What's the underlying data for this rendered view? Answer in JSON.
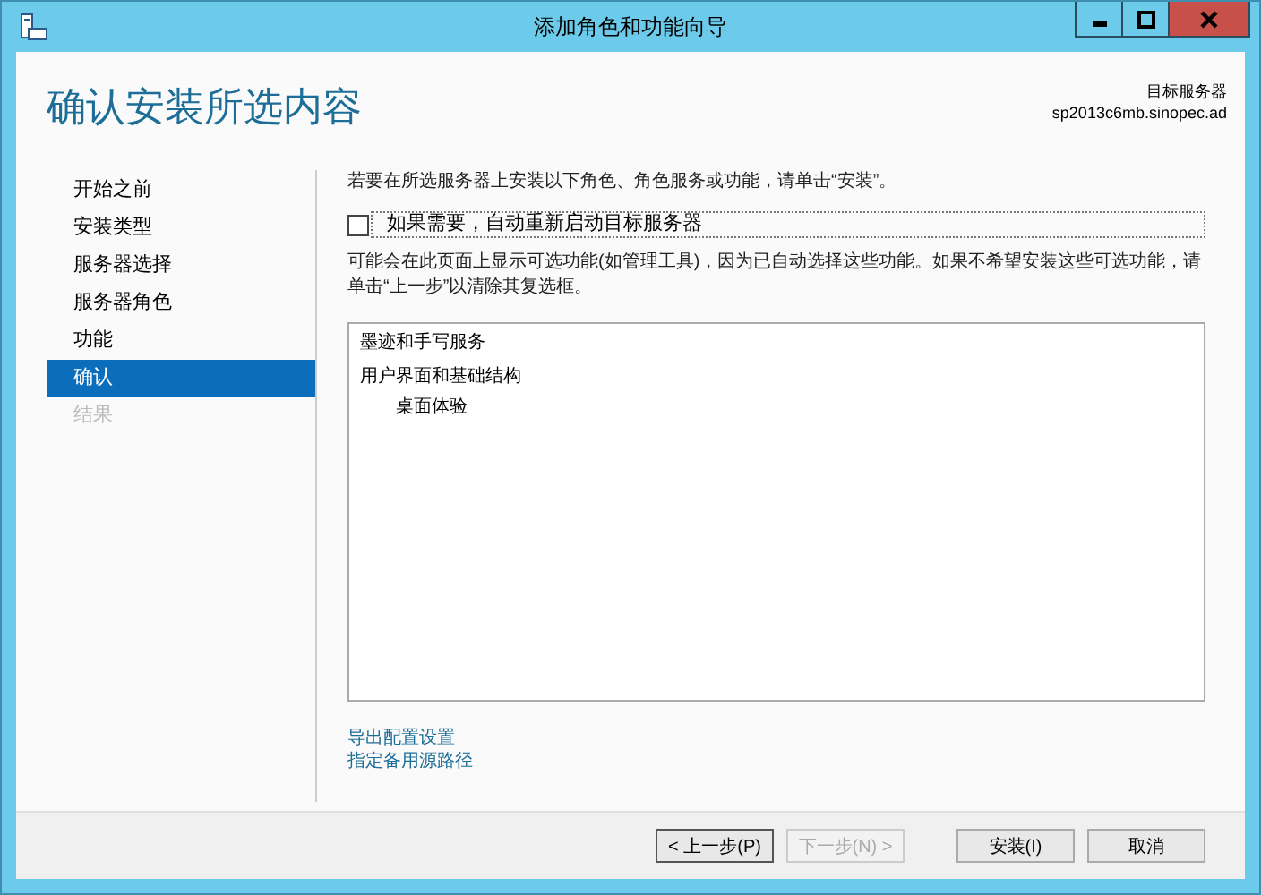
{
  "window": {
    "title": "添加角色和功能向导"
  },
  "header": {
    "title": "确认安装所选内容",
    "server_label": "目标服务器",
    "server_name": "sp2013c6mb.sinopec.ad"
  },
  "sidebar": {
    "items": [
      {
        "label": "开始之前",
        "selected": false,
        "disabled": false
      },
      {
        "label": "安装类型",
        "selected": false,
        "disabled": false
      },
      {
        "label": "服务器选择",
        "selected": false,
        "disabled": false
      },
      {
        "label": "服务器角色",
        "selected": false,
        "disabled": false
      },
      {
        "label": "功能",
        "selected": false,
        "disabled": false
      },
      {
        "label": "确认",
        "selected": true,
        "disabled": false
      },
      {
        "label": "结果",
        "selected": false,
        "disabled": true
      }
    ]
  },
  "content": {
    "intro": "若要在所选服务器上安装以下角色、角色服务或功能，请单击“安装”。",
    "restart": {
      "label": "如果需要，自动重新启动目标服务器",
      "checked": false
    },
    "note": "可能会在此页面上显示可选功能(如管理工具)，因为已自动选择这些功能。如果不希望安装这些可选功能，请单击“上一步”以清除其复选框。",
    "features": [
      {
        "label": "墨迹和手写服务"
      },
      {
        "label": "用户界面和基础结构",
        "children": [
          {
            "label": "桌面体验"
          }
        ]
      }
    ],
    "links": [
      "导出配置设置",
      "指定备用源路径"
    ]
  },
  "buttons": [
    {
      "label": "< 上一步(P)",
      "disabled": false
    },
    {
      "label": "下一步(N) >",
      "disabled": true
    },
    {
      "label": "安装(I)",
      "disabled": false
    },
    {
      "label": "取消",
      "disabled": false
    }
  ]
}
